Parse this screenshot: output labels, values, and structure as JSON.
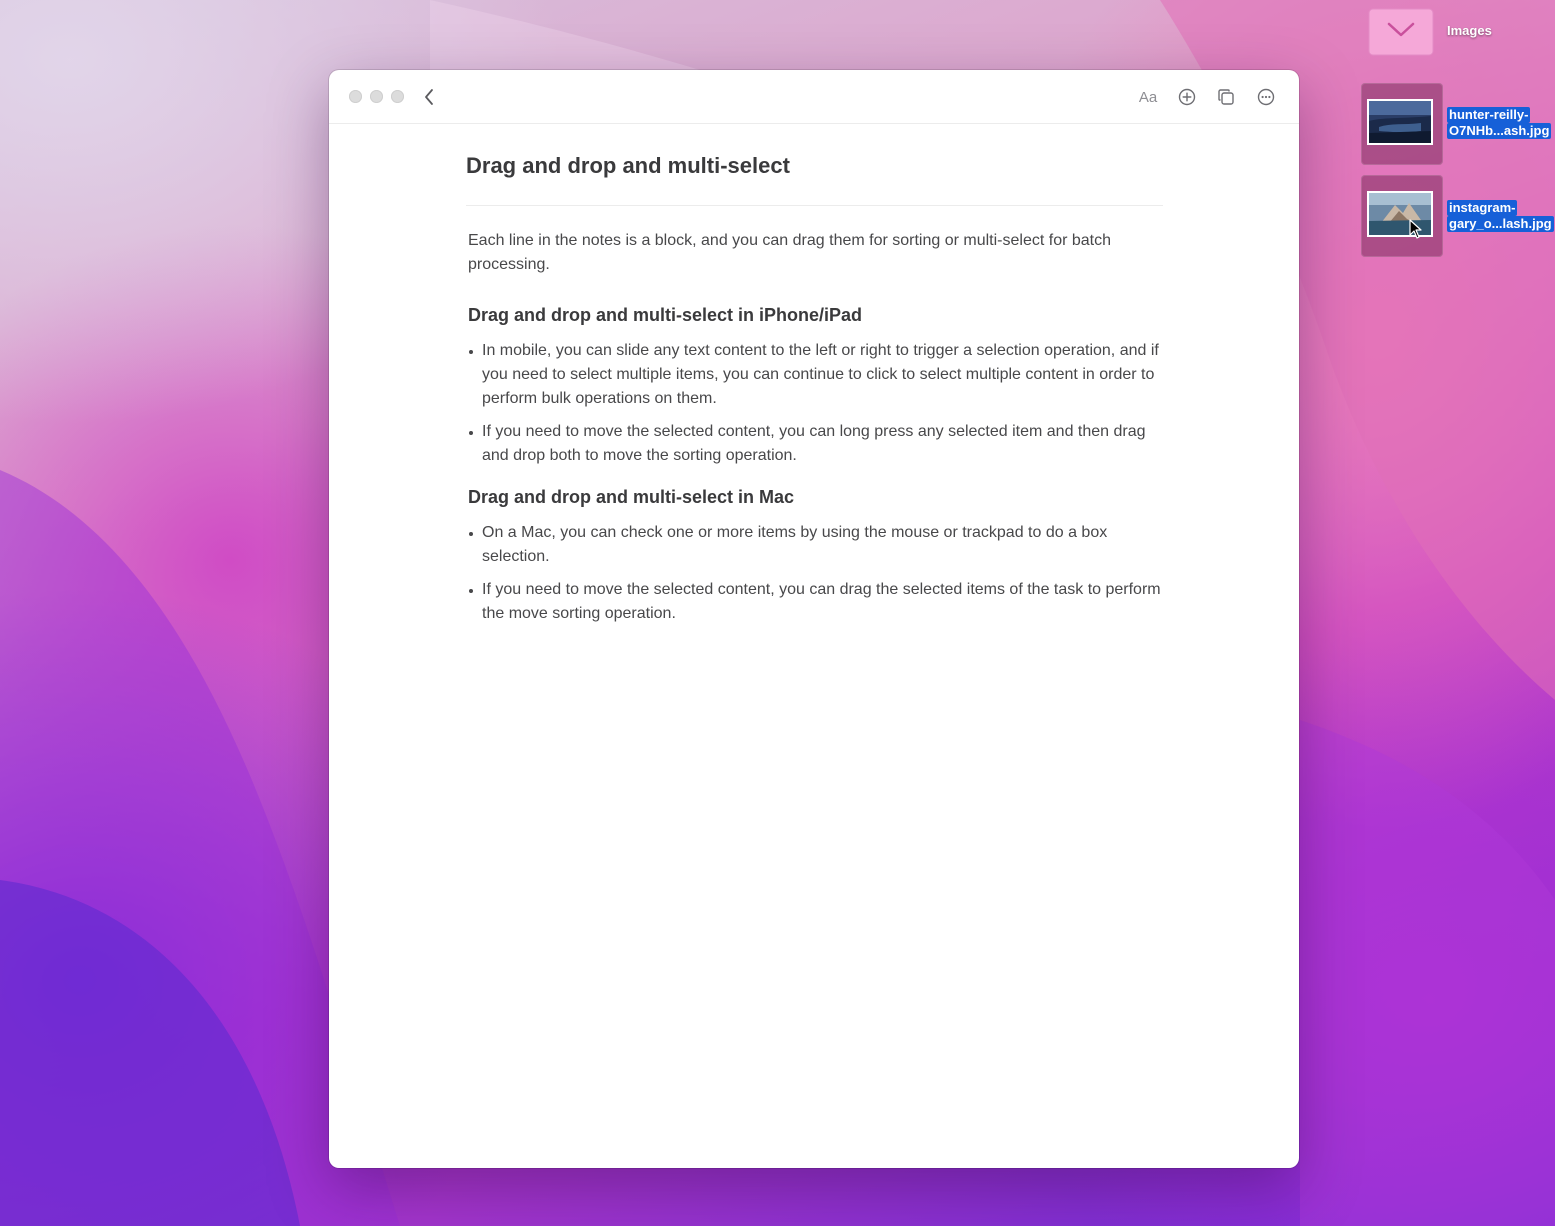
{
  "desktop": {
    "folder": {
      "label": "Images",
      "icon": "folder-icon"
    },
    "files": [
      {
        "label_line1": "hunter-reilly-",
        "label_line2": "O7NHb...ash.jpg",
        "icon": "image-thumbnail-icon"
      },
      {
        "label_line1": "instagram-",
        "label_line2": "gary_o...lash.jpg",
        "icon": "image-thumbnail-icon"
      }
    ]
  },
  "window": {
    "toolbar": {
      "font_label": "Aa",
      "icons": [
        "back-chevron-icon",
        "add-circle-icon",
        "copy-icon",
        "more-options-icon"
      ]
    },
    "note": {
      "title": "Drag and drop and multi-select",
      "intro": "Each line in the notes is a block, and you can drag them for sorting or multi-select for batch processing.",
      "sections": [
        {
          "heading": "Drag and drop and multi-select in iPhone/iPad",
          "bullets": [
            "In mobile, you can slide any text content to the left or right to trigger a selection operation, and if you need to select multiple items, you can continue to click to select multiple content in order to perform bulk operations on them.",
            "If you need to move the selected content, you can long press any selected item and then drag and drop both to move the sorting operation."
          ]
        },
        {
          "heading": "Drag and drop and multi-select in Mac",
          "bullets": [
            "On a Mac, you can check one or more items by using the mouse or trackpad to do a box selection.",
            "If you need to move the selected content, you can drag the selected items of the task to perform the move sorting operation."
          ]
        }
      ]
    }
  },
  "colors": {
    "selection_blue": "#1660d8",
    "text_primary": "#3a3a3c",
    "toolbar_icon": "#6e6e73"
  }
}
